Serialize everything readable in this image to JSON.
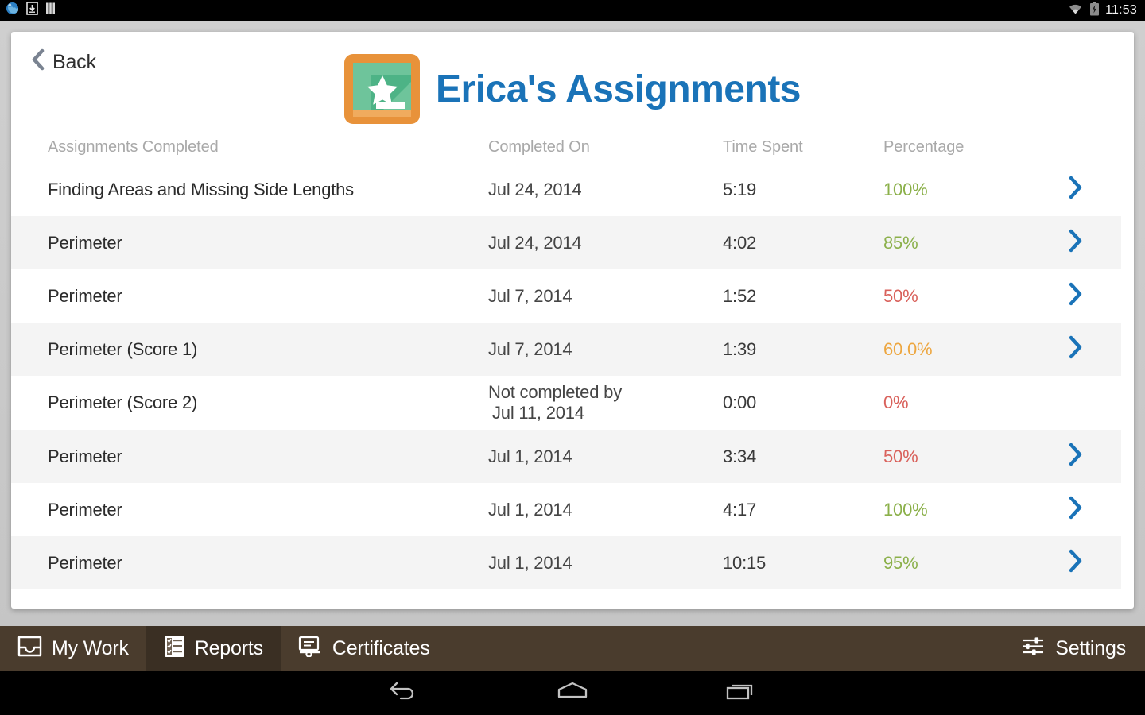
{
  "status_bar": {
    "icons": [
      "browser-icon",
      "download-icon",
      "sim-card-icon"
    ],
    "wifi_icon": "wifi-icon",
    "battery_icon": "battery-charging-icon",
    "clock": "11:53"
  },
  "header": {
    "back_label": "Back",
    "back_icon": "chevron-left-icon",
    "app_icon": "classroom-chalkboard-star-icon",
    "title": "Erica's Assignments"
  },
  "table": {
    "columns": [
      {
        "key": "name",
        "label": "Assignments Completed"
      },
      {
        "key": "date",
        "label": "Completed On"
      },
      {
        "key": "time",
        "label": "Time Spent"
      },
      {
        "key": "pct",
        "label": "Percentage"
      }
    ],
    "rows": [
      {
        "name": "Finding Areas and Missing Side Lengths",
        "date": "Jul 24, 2014",
        "date2": "",
        "time": "5:19",
        "pct": "100%",
        "pct_color": "#8bb04a",
        "chevron": true,
        "alt": false
      },
      {
        "name": "Perimeter",
        "date": "Jul 24, 2014",
        "date2": "",
        "time": "4:02",
        "pct": "85%",
        "pct_color": "#8bb04a",
        "chevron": true,
        "alt": true
      },
      {
        "name": "Perimeter",
        "date": "Jul 7, 2014",
        "date2": "",
        "time": "1:52",
        "pct": "50%",
        "pct_color": "#d9615b",
        "chevron": true,
        "alt": false
      },
      {
        "name": "Perimeter (Score 1)",
        "date": "Jul 7, 2014",
        "date2": "",
        "time": "1:39",
        "pct": "60.0%",
        "pct_color": "#eda63f",
        "chevron": true,
        "alt": true
      },
      {
        "name": "Perimeter (Score 2)",
        "date": "Not completed by",
        "date2": "Jul 11, 2014",
        "time": "0:00",
        "pct": "0%",
        "pct_color": "#d9615b",
        "chevron": false,
        "alt": false
      },
      {
        "name": "Perimeter",
        "date": "Jul 1, 2014",
        "date2": "",
        "time": "3:34",
        "pct": "50%",
        "pct_color": "#d9615b",
        "chevron": true,
        "alt": true
      },
      {
        "name": "Perimeter",
        "date": "Jul 1, 2014",
        "date2": "",
        "time": "4:17",
        "pct": "100%",
        "pct_color": "#8bb04a",
        "chevron": true,
        "alt": false
      },
      {
        "name": "Perimeter",
        "date": "Jul 1, 2014",
        "date2": "",
        "time": "10:15",
        "pct": "95%",
        "pct_color": "#8bb04a",
        "chevron": true,
        "alt": true
      }
    ]
  },
  "tabbar": {
    "items": [
      {
        "label": "My Work",
        "icon": "inbox-icon",
        "active": false
      },
      {
        "label": "Reports",
        "icon": "checklist-icon",
        "active": true
      },
      {
        "label": "Certificates",
        "icon": "certificate-icon",
        "active": false
      }
    ],
    "settings": {
      "label": "Settings",
      "icon": "sliders-icon"
    }
  },
  "navbar": {
    "back": "android-back-icon",
    "home": "android-home-icon",
    "recents": "android-recents-icon"
  },
  "colors": {
    "title_blue": "#1a73b8",
    "chevron_blue": "#1a73b8",
    "green": "#8bb04a",
    "red": "#d9615b",
    "orange": "#eda63f",
    "tabbar_brown": "#4a3c2d",
    "tabbar_active": "#3a2f23"
  }
}
